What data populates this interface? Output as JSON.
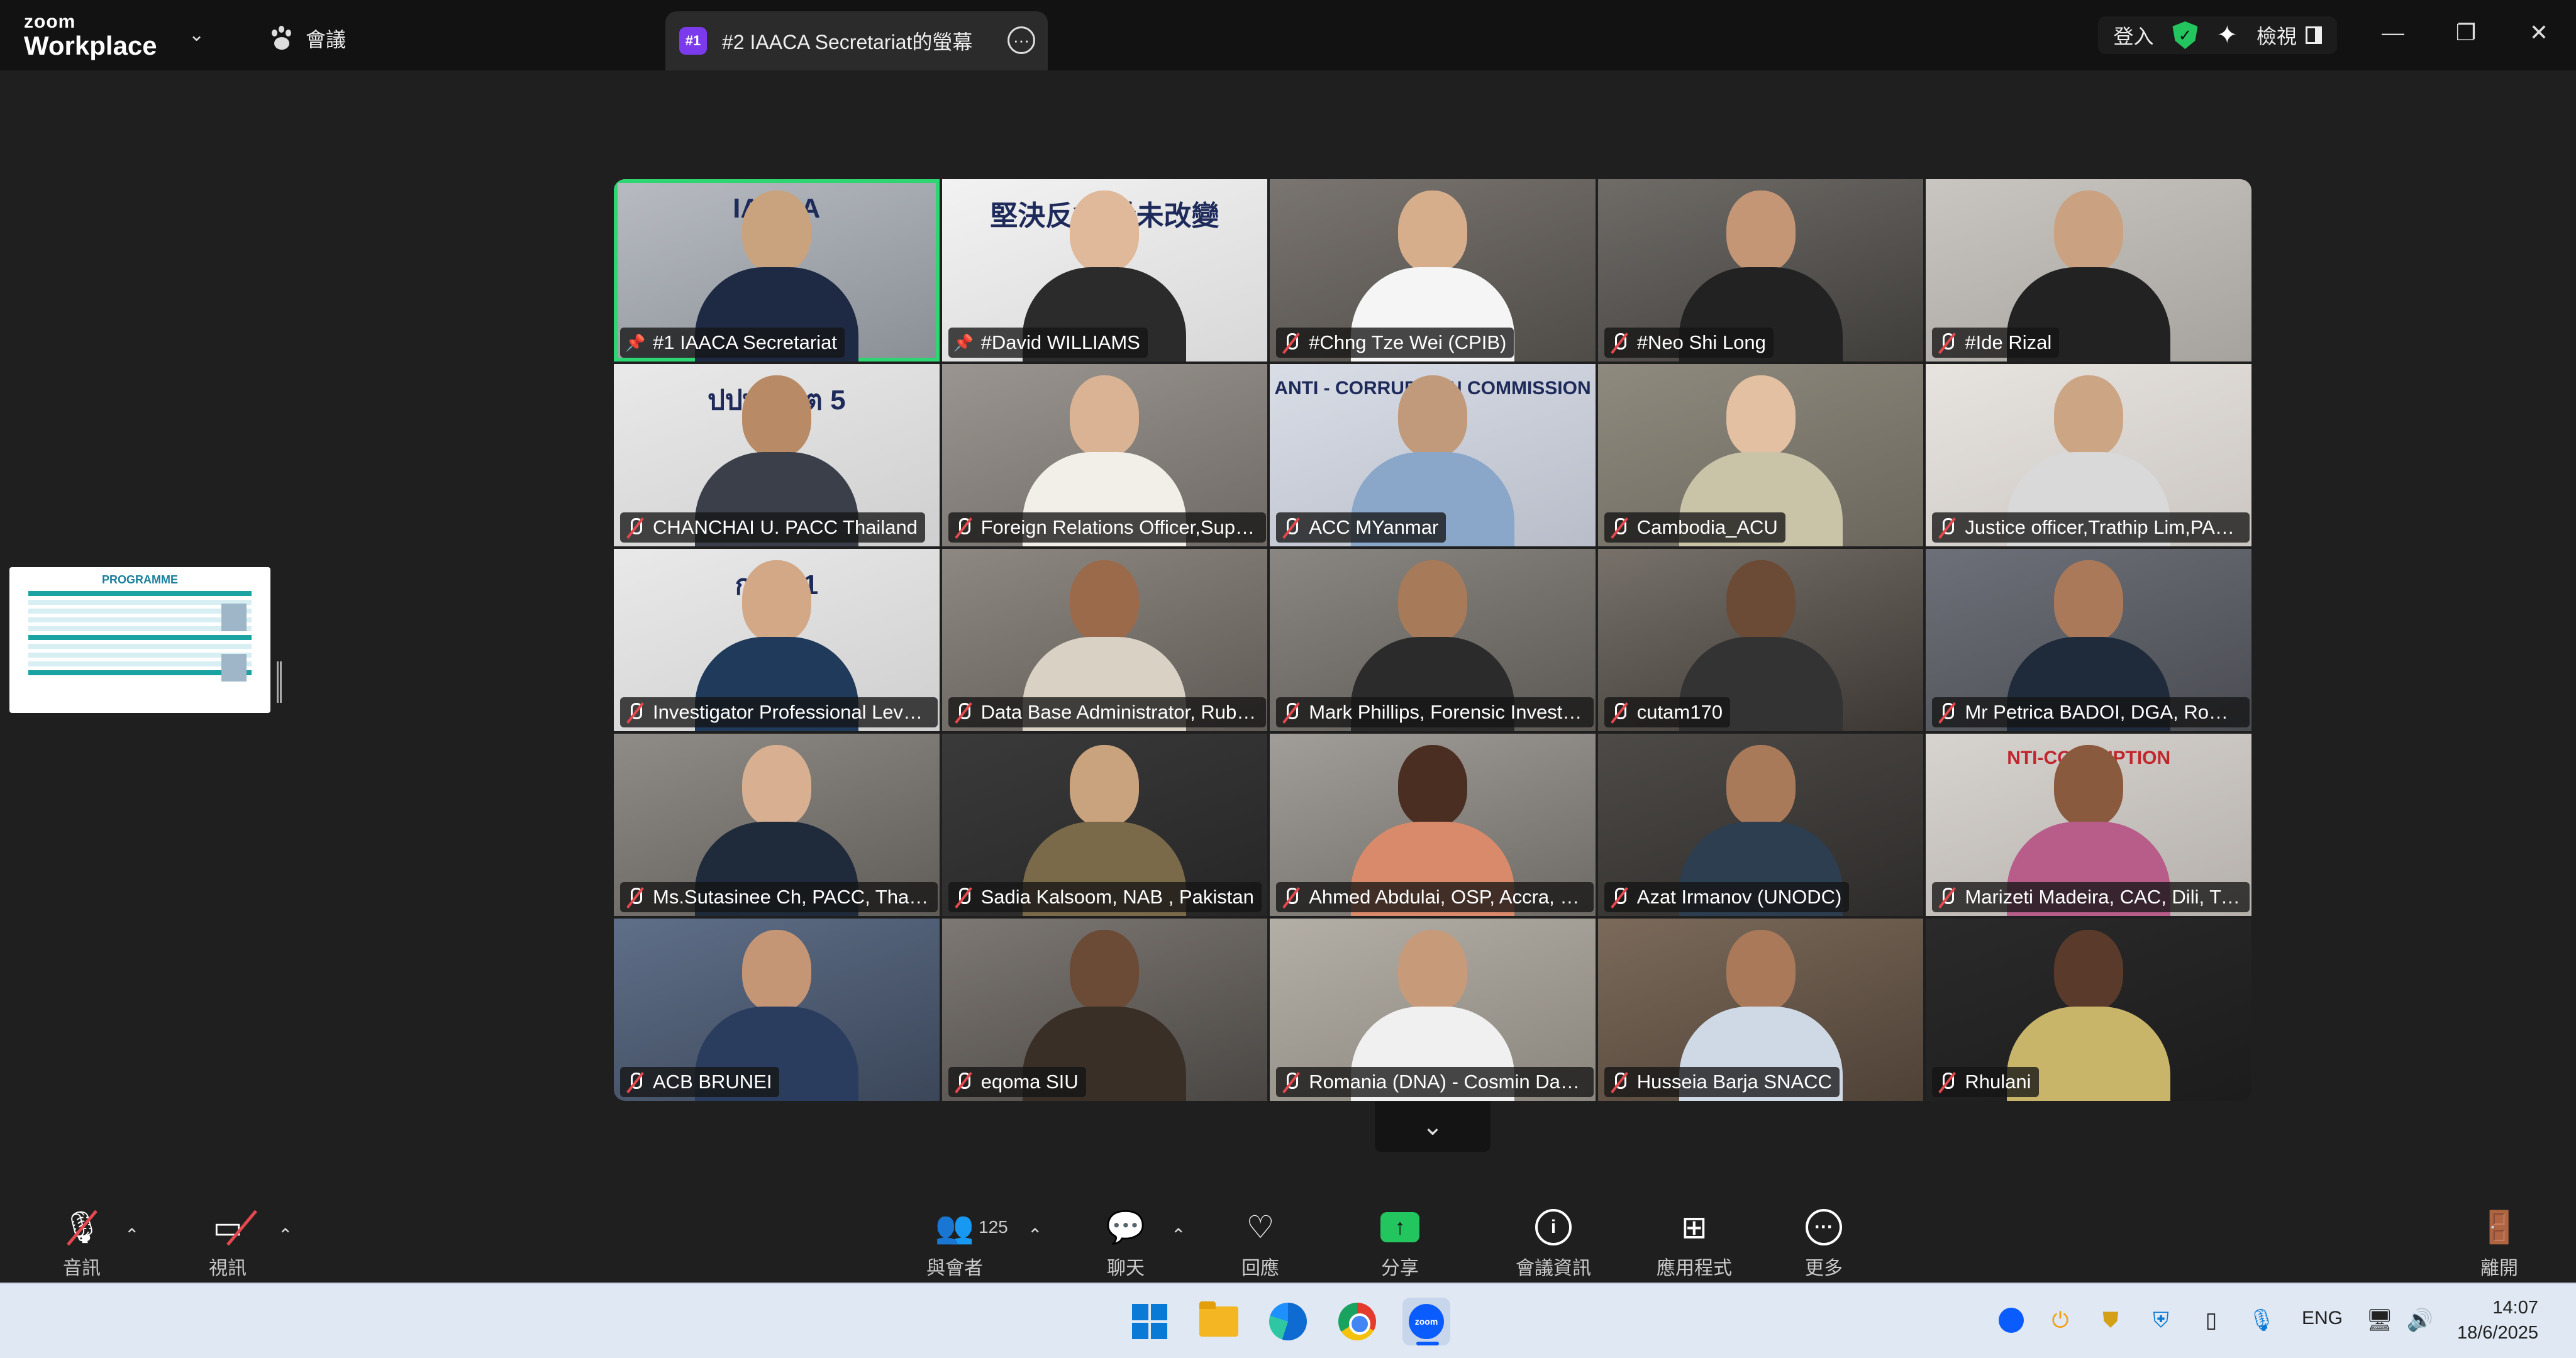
{
  "app": {
    "brand_top": "zoom",
    "brand_bottom": "Workplace",
    "meeting_label": "會議"
  },
  "tab": {
    "badge": "#1",
    "title": "#2 IAACA Secretariat的螢幕"
  },
  "top_right": {
    "sign_in": "登入",
    "view": "檢視"
  },
  "thumbnail": {
    "title": "PROGRAMME"
  },
  "participants": [
    {
      "name": "#1 IAACA Secretariat",
      "icon": "pin-icon",
      "sign": "IAACA"
    },
    {
      "name": "#David WILLIAMS",
      "icon": "pin-icon",
      "sign": "堅決反貪 從未改變"
    },
    {
      "name": "#Chng Tze Wei (CPIB)",
      "icon": "mic-muted-icon"
    },
    {
      "name": "#Neo Shi Long",
      "icon": "mic-muted-icon"
    },
    {
      "name": "#Ide Rizal",
      "icon": "mic-muted-icon"
    },
    {
      "name": "CHANCHAI U.  PACC Thailand",
      "icon": "mic-muted-icon",
      "sign": "ปปท. เขต 5"
    },
    {
      "name": "Foreign Relations Officer,Supap...",
      "icon": "mic-muted-icon"
    },
    {
      "name": "ACC MYanmar",
      "icon": "mic-muted-icon",
      "sign": "ANTI - CORRUPTION COMMISSION"
    },
    {
      "name": "Cambodia_ACU",
      "icon": "mic-muted-icon"
    },
    {
      "name": "Justice officer,Trathip Lim,PACC,...",
      "icon": "mic-muted-icon"
    },
    {
      "name": "Investigator Professional Level,...",
      "icon": "mic-muted-icon",
      "sign": "กปท. 1"
    },
    {
      "name": "Data Base Administrator, Rube...",
      "icon": "mic-muted-icon"
    },
    {
      "name": "Mark Phillips, Forensic Investiga...",
      "icon": "mic-muted-icon"
    },
    {
      "name": "cutam170",
      "icon": "mic-muted-icon"
    },
    {
      "name": "Mr Petrica BADOI, DGA, Romania",
      "icon": "mic-muted-icon"
    },
    {
      "name": "Ms.Sutasinee Ch, PACC, Thailand",
      "icon": "mic-muted-icon"
    },
    {
      "name": "Sadia Kalsoom, NAB , Pakistan",
      "icon": "mic-muted-icon"
    },
    {
      "name": "Ahmed Abdulai, OSP, Accra, Gh...",
      "icon": "mic-muted-icon"
    },
    {
      "name": "Azat Irmanov (UNODC)",
      "icon": "mic-muted-icon"
    },
    {
      "name": "Marizeti Madeira, CAC, Dili, Tim...",
      "icon": "mic-muted-icon",
      "sign": "NTI-CORRUPTION"
    },
    {
      "name": "ACB BRUNEI",
      "icon": "mic-muted-icon"
    },
    {
      "name": "eqoma SIU",
      "icon": "mic-muted-icon"
    },
    {
      "name": "Romania (DNA) - Cosmin Danie...",
      "icon": "mic-muted-icon"
    },
    {
      "name": "Husseia Barja SNACC",
      "icon": "mic-muted-icon"
    },
    {
      "name": "Rhulani",
      "icon": "mic-muted-icon"
    }
  ],
  "toolbar": {
    "audio": "音訊",
    "video": "視訊",
    "participants": "與會者",
    "participant_count": "125",
    "chat": "聊天",
    "react": "回應",
    "share": "分享",
    "meeting_info": "會議資訊",
    "apps": "應用程式",
    "more": "更多",
    "leave": "離開"
  },
  "taskbar": {
    "lang": "ENG",
    "time": "14:07",
    "date": "18/6/2025"
  },
  "colors": {
    "active_speaker": "#2ed573",
    "share_green": "#22c55e",
    "muted_red": "#e5484d",
    "tab_badge": "#7c3aed"
  }
}
